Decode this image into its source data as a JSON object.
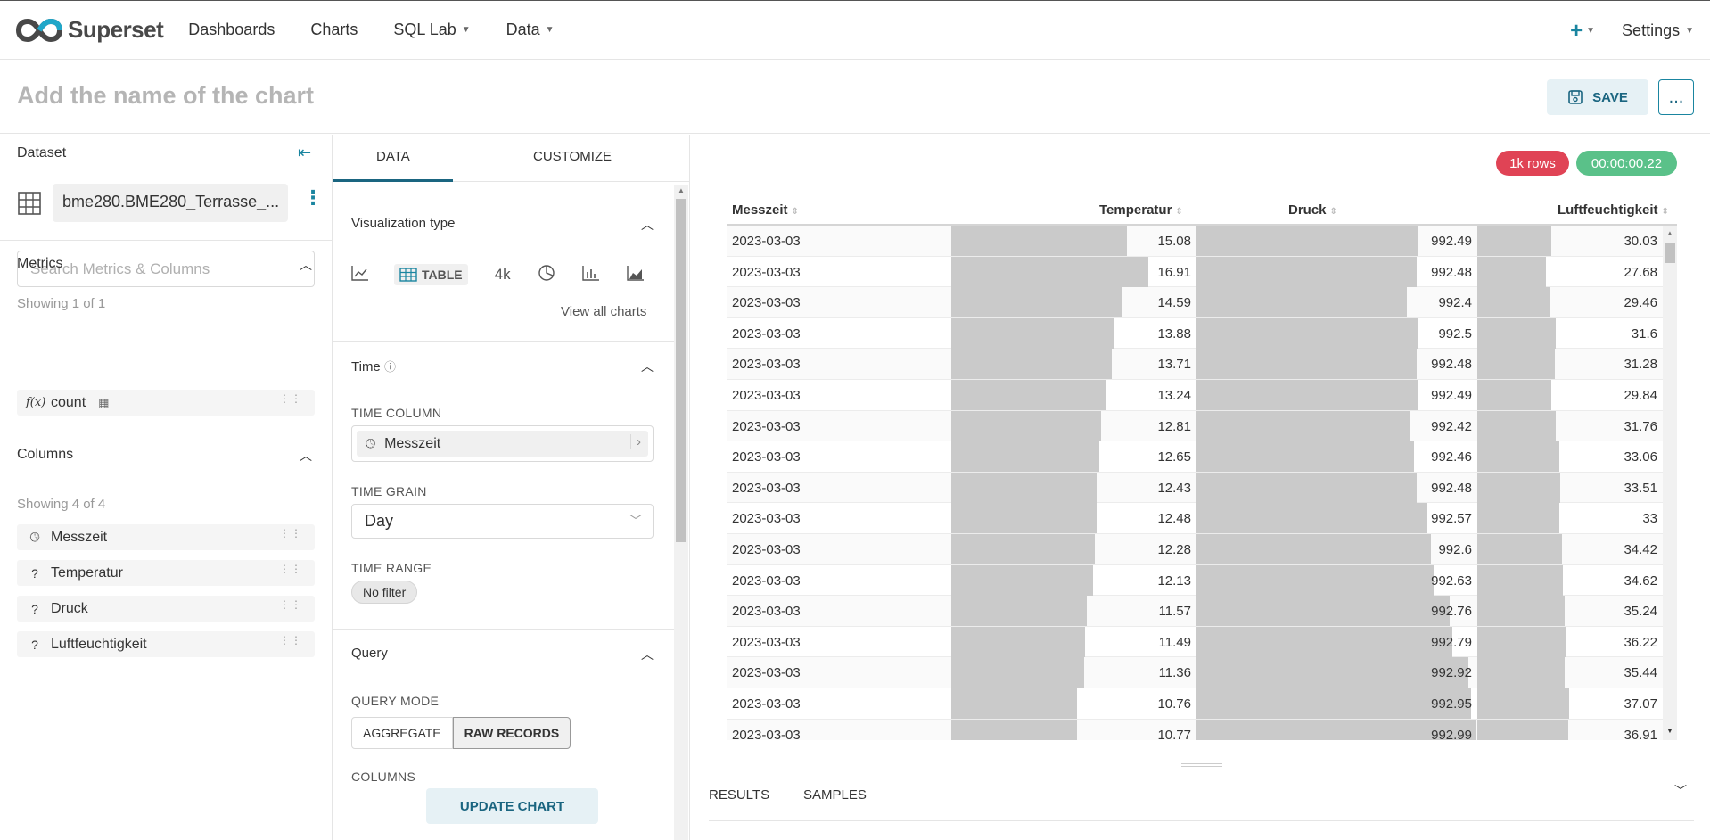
{
  "app": {
    "brand": "Superset",
    "nav": [
      "Dashboards",
      "Charts",
      "SQL Lab",
      "Data"
    ],
    "plus_label": "+",
    "settings_label": "Settings"
  },
  "title_bar": {
    "chart_title_placeholder": "Add the name of the chart",
    "save_label": "SAVE",
    "more_label": "..."
  },
  "dataset_panel": {
    "label": "Dataset",
    "dataset_name": "bme280.BME280_Terrasse_...",
    "search_placeholder": "Search Metrics & Columns",
    "metrics_heading": "Metrics",
    "metrics_showing": "Showing 1 of 1",
    "metrics": [
      {
        "prefix": "f(x)",
        "name": "count"
      }
    ],
    "columns_heading": "Columns",
    "columns_showing": "Showing 4 of 4",
    "columns": [
      {
        "type_icon": "clock-icon",
        "name": "Messzeit"
      },
      {
        "type_icon": "question-icon",
        "name": "Temperatur"
      },
      {
        "type_icon": "question-icon",
        "name": "Druck"
      },
      {
        "type_icon": "question-icon",
        "name": "Luftfeuchtigkeit"
      }
    ]
  },
  "control_panel": {
    "tabs": [
      "DATA",
      "CUSTOMIZE"
    ],
    "viz_heading": "Visualization type",
    "viz_table_label": "TABLE",
    "viz_big_number_label": "4k",
    "view_all_label": "View all charts",
    "time_heading": "Time",
    "time_column_label": "TIME COLUMN",
    "time_column_value": "Messzeit",
    "time_grain_label": "TIME GRAIN",
    "time_grain_value": "Day",
    "time_range_label": "TIME RANGE",
    "time_range_value": "No filter",
    "query_heading": "Query",
    "query_mode_label": "QUERY MODE",
    "query_modes": [
      "AGGREGATE",
      "RAW RECORDS"
    ],
    "query_mode_selected": "RAW RECORDS",
    "columns_label": "COLUMNS",
    "update_label": "UPDATE CHART"
  },
  "results": {
    "rows_badge": "1k rows",
    "time_badge": "00:00:00.22",
    "columns": [
      "Messzeit",
      "Temperatur",
      "Druck",
      "Luftfeuchtigkeit"
    ],
    "rows": [
      [
        "2023-03-03",
        "15.08",
        "992.49",
        "30.03"
      ],
      [
        "2023-03-03",
        "16.91",
        "992.48",
        "27.68"
      ],
      [
        "2023-03-03",
        "14.59",
        "992.4",
        "29.46"
      ],
      [
        "2023-03-03",
        "13.88",
        "992.5",
        "31.6"
      ],
      [
        "2023-03-03",
        "13.71",
        "992.48",
        "31.28"
      ],
      [
        "2023-03-03",
        "13.24",
        "992.49",
        "29.84"
      ],
      [
        "2023-03-03",
        "12.81",
        "992.42",
        "31.76"
      ],
      [
        "2023-03-03",
        "12.65",
        "992.46",
        "33.06"
      ],
      [
        "2023-03-03",
        "12.43",
        "992.48",
        "33.51"
      ],
      [
        "2023-03-03",
        "12.48",
        "992.57",
        "33"
      ],
      [
        "2023-03-03",
        "12.28",
        "992.6",
        "34.42"
      ],
      [
        "2023-03-03",
        "12.13",
        "992.63",
        "34.62"
      ],
      [
        "2023-03-03",
        "11.57",
        "992.76",
        "35.24"
      ],
      [
        "2023-03-03",
        "11.49",
        "992.79",
        "36.22"
      ],
      [
        "2023-03-03",
        "11.36",
        "992.92",
        "35.44"
      ],
      [
        "2023-03-03",
        "10.76",
        "992.95",
        "37.07"
      ],
      [
        "2023-03-03",
        "10.77",
        "992.99",
        "36.91"
      ]
    ],
    "bottom_tabs": [
      "RESULTS",
      "SAMPLES"
    ]
  },
  "colors": {
    "accent": "#1a85a0",
    "rows_badge": "#e04355",
    "time_badge": "#5ac189",
    "bar": "#cacaca"
  }
}
